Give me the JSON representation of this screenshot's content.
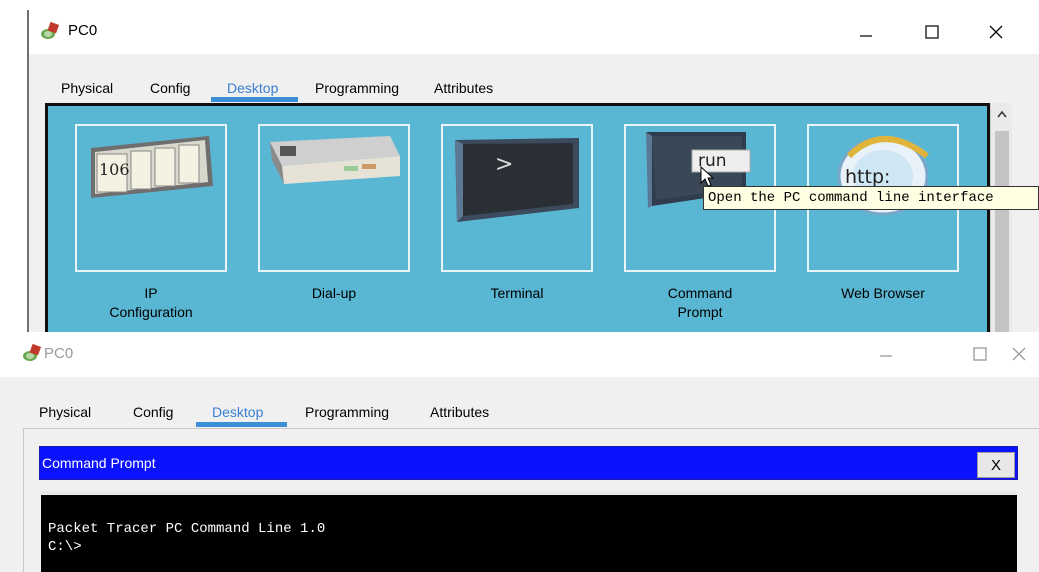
{
  "window_top": {
    "title": "PC0",
    "icon": "packet-tracer-pc-icon",
    "controls": {
      "minimize": "minimize-icon",
      "maximize": "maximize-icon",
      "close": "close-icon"
    },
    "tabs": [
      {
        "label": "Physical"
      },
      {
        "label": "Config"
      },
      {
        "label": "Desktop",
        "active": true
      },
      {
        "label": "Programming"
      },
      {
        "label": "Attributes"
      }
    ],
    "apps": [
      {
        "label": "IP\nConfiguration",
        "icon": "ip-configuration-icon",
        "icon_text": "106"
      },
      {
        "label": "Dial-up",
        "icon": "modem-icon"
      },
      {
        "label": "Terminal",
        "icon": "terminal-icon",
        "icon_text": ">"
      },
      {
        "label": "Command\nPrompt",
        "icon": "command-prompt-icon",
        "icon_text": "run"
      },
      {
        "label": "Web Browser",
        "icon": "web-browser-icon",
        "icon_text": "http:"
      }
    ],
    "tooltip": "Open the PC command line interface",
    "panel_color": "#5ab7d4"
  },
  "window_bottom": {
    "title": "PC0",
    "icon": "packet-tracer-pc-icon",
    "tabs": [
      {
        "label": "Physical"
      },
      {
        "label": "Config"
      },
      {
        "label": "Desktop",
        "active": true
      },
      {
        "label": "Programming"
      },
      {
        "label": "Attributes"
      }
    ],
    "command_prompt": {
      "title": "Command Prompt",
      "close_label": "X",
      "title_color": "#0a12ff",
      "lines": [
        "Packet Tracer PC Command Line 1.0",
        "C:\\>"
      ]
    }
  }
}
